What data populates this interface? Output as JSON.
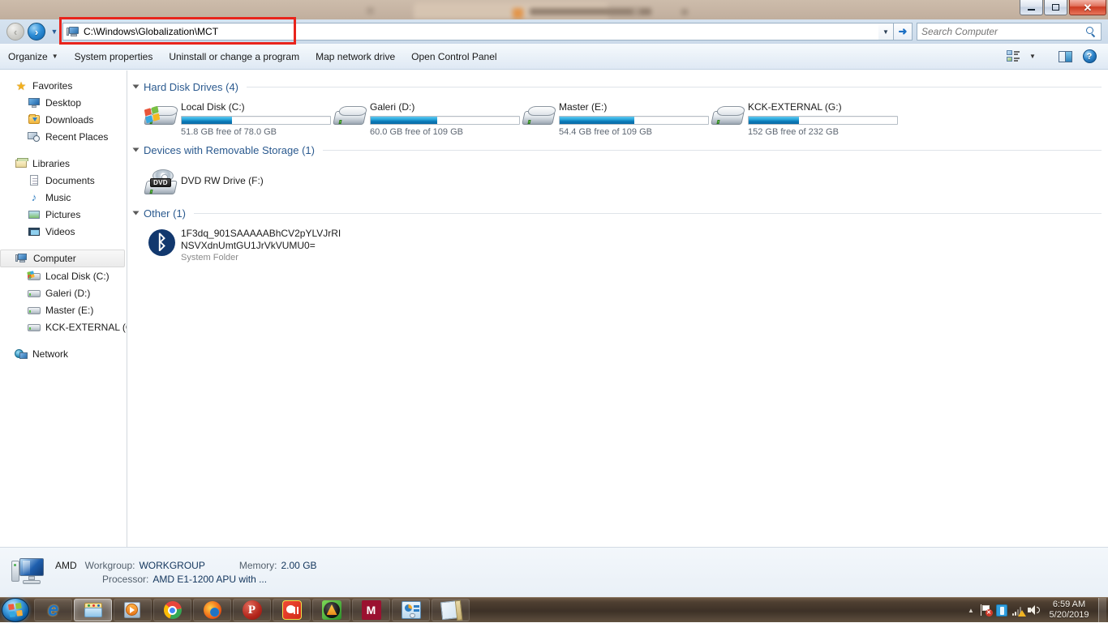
{
  "window": {
    "controls": {
      "minimize": "–",
      "maximize": "❐",
      "close": "✕"
    }
  },
  "background_window": {
    "present": true
  },
  "address_bar": {
    "back_label": "◀",
    "forward_label": "➤",
    "history_caret": "▼",
    "path": "C:\\Windows\\Globalization\\MCT",
    "icon": "computer-icon",
    "dropdown_caret": "▼",
    "go_label": "➜",
    "highlight_color": "#e8241c"
  },
  "search": {
    "placeholder": "Search Computer",
    "value": "",
    "icon": "search-icon"
  },
  "toolbar": {
    "items": [
      {
        "label": "Organize",
        "has_caret": true
      },
      {
        "label": "System properties",
        "has_caret": false
      },
      {
        "label": "Uninstall or change a program",
        "has_caret": false
      },
      {
        "label": "Map network drive",
        "has_caret": false
      },
      {
        "label": "Open Control Panel",
        "has_caret": false
      }
    ],
    "caret": "▼",
    "views_caret": "▼",
    "help_label": "?"
  },
  "sidebar": {
    "groups": [
      {
        "header": {
          "label": "Favorites",
          "icon": "star-icon"
        },
        "items": [
          {
            "label": "Desktop",
            "icon": "desktop-icon"
          },
          {
            "label": "Downloads",
            "icon": "downloads-icon"
          },
          {
            "label": "Recent Places",
            "icon": "recent-places-icon"
          }
        ]
      },
      {
        "header": {
          "label": "Libraries",
          "icon": "libraries-icon"
        },
        "items": [
          {
            "label": "Documents",
            "icon": "documents-icon"
          },
          {
            "label": "Music",
            "icon": "music-icon"
          },
          {
            "label": "Pictures",
            "icon": "pictures-icon"
          },
          {
            "label": "Videos",
            "icon": "videos-icon"
          }
        ]
      },
      {
        "header": {
          "label": "Computer",
          "icon": "computer-icon",
          "selected": true
        },
        "items": [
          {
            "label": "Local Disk (C:)",
            "icon": "hdd-windows-icon"
          },
          {
            "label": "Galeri (D:)",
            "icon": "hdd-icon"
          },
          {
            "label": "Master (E:)",
            "icon": "hdd-icon"
          },
          {
            "label": "KCK-EXTERNAL (G:)",
            "icon": "hdd-icon"
          }
        ]
      },
      {
        "header": {
          "label": "Network",
          "icon": "network-icon"
        },
        "items": []
      }
    ]
  },
  "content": {
    "sections": [
      {
        "title": "Hard Disk Drives (4)",
        "collapsed": false,
        "items": [
          {
            "name": "Local Disk (C:)",
            "sub": "51.8 GB free of 78.0 GB",
            "fill_percent": 34,
            "icon": "drive-windows-icon"
          },
          {
            "name": "Galeri (D:)",
            "sub": "60.0 GB free of 109 GB",
            "fill_percent": 45,
            "icon": "drive-icon"
          },
          {
            "name": "Master (E:)",
            "sub": "54.4 GB free of 109 GB",
            "fill_percent": 50,
            "icon": "drive-icon"
          },
          {
            "name": "KCK-EXTERNAL (G:)",
            "sub": "152 GB free of 232 GB",
            "fill_percent": 34,
            "icon": "drive-icon"
          }
        ]
      },
      {
        "title": "Devices with Removable Storage (1)",
        "collapsed": false,
        "items": [
          {
            "name": "DVD RW Drive (F:)",
            "sub": "",
            "icon": "dvd-drive-icon",
            "badge": "DVD"
          }
        ]
      },
      {
        "title": "Other (1)",
        "collapsed": false,
        "items": [
          {
            "name": "1F3dq_901SAAAAABhCV2pYLVJrRI",
            "name2": "NSVXdnUmtGU1JrVkVUMU0=",
            "sub": "System Folder",
            "icon": "bluetooth-icon",
            "glyph": "ᛒ"
          }
        ]
      }
    ]
  },
  "status_bar": {
    "computer_name": "AMD",
    "workgroup_label": "Workgroup:",
    "workgroup_value": "WORKGROUP",
    "memory_label": "Memory:",
    "memory_value": "2.00 GB",
    "processor_label": "Processor:",
    "processor_value": "AMD E1-1200 APU with ..."
  },
  "taskbar": {
    "start_label": "Start",
    "buttons": [
      {
        "name": "internet-explorer",
        "active": false
      },
      {
        "name": "windows-explorer",
        "active": true
      },
      {
        "name": "windows-media-player",
        "active": false
      },
      {
        "name": "google-chrome",
        "active": false
      },
      {
        "name": "mozilla-firefox",
        "active": false
      },
      {
        "name": "p-app",
        "label": "P",
        "active": false
      },
      {
        "name": "gom-player",
        "active": false
      },
      {
        "name": "aimp-player",
        "active": false
      },
      {
        "name": "m-app",
        "label": "M",
        "active": false
      },
      {
        "name": "system-utility",
        "active": false
      },
      {
        "name": "notepad-app",
        "active": false
      }
    ],
    "tray": {
      "chevron": "▲",
      "icons": [
        "action-center-flag-icon",
        "battery-icon",
        "network-icon",
        "volume-icon"
      ]
    },
    "clock": {
      "time": "6:59 AM",
      "date": "5/20/2019"
    }
  }
}
